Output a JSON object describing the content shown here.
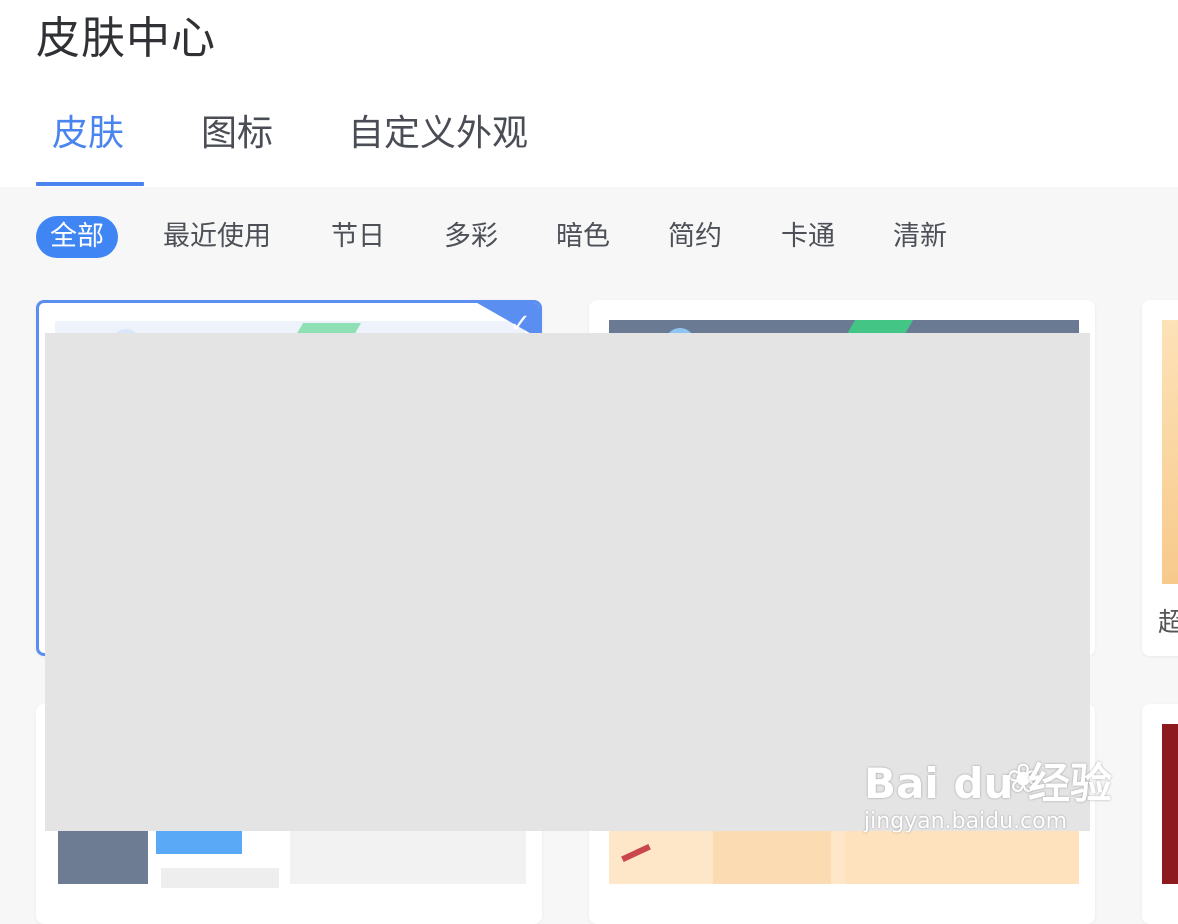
{
  "header": {
    "title": "皮肤中心"
  },
  "tabs": [
    {
      "label": "皮肤",
      "active": true
    },
    {
      "label": "图标",
      "active": false
    },
    {
      "label": "自定义外观",
      "active": false
    }
  ],
  "categories": [
    {
      "label": "全部",
      "active": true
    },
    {
      "label": "最近使用"
    },
    {
      "label": "节日"
    },
    {
      "label": "多彩"
    },
    {
      "label": "暗色"
    },
    {
      "label": "简约"
    },
    {
      "label": "卡通"
    },
    {
      "label": "清新"
    }
  ],
  "cards": {
    "peek_label": "超",
    "selected_check": "✓"
  },
  "watermark": {
    "main": "Bai du 经验",
    "sub": "jingyan.baidu.com"
  },
  "colors": {
    "accent": "#4a84ee",
    "category_active_bg": "#3f86f4",
    "overlay": "#e4e4e4",
    "background": "#f7f7f8"
  }
}
